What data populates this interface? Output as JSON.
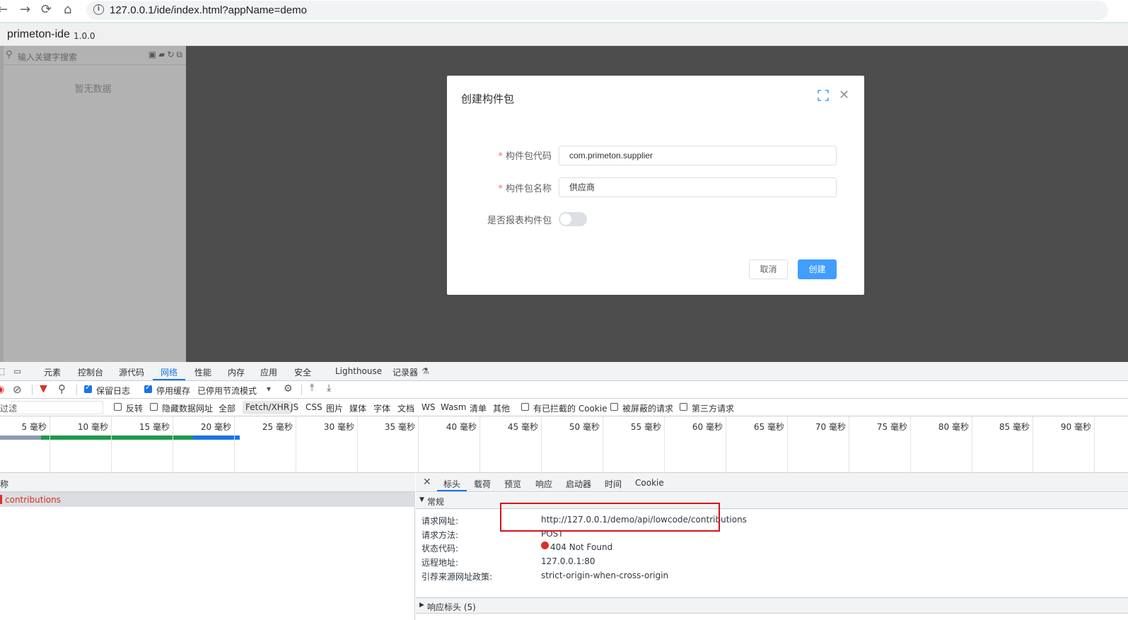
{
  "browser": {
    "url": "127.0.0.1/ide/index.html?appName=demo",
    "icons": [
      "back-icon",
      "forward-icon",
      "reload-icon",
      "home-icon",
      "info-icon"
    ]
  },
  "app": {
    "name": "primeton-ide",
    "version": "1.0.0"
  },
  "sidebar": {
    "search_placeholder": "输入关键字搜索",
    "empty_text": "暂无数据"
  },
  "dialog": {
    "title": "创建构件包",
    "fields": [
      {
        "label": "构件包代码",
        "required": true,
        "value": "com.primeton.supplier"
      },
      {
        "label": "构件包名称",
        "required": true,
        "value": "供应商"
      }
    ],
    "switch": {
      "label": "是否报表构件包",
      "on": false
    },
    "cancel_label": "取消",
    "create_label": "创建",
    "accent": "#409eff"
  },
  "devtools": {
    "tabs": [
      "元素",
      "控制台",
      "源代码",
      "网络",
      "性能",
      "内存",
      "应用",
      "安全",
      "Lighthouse",
      "记录器"
    ],
    "active_tab": "网络",
    "toolbar": {
      "preserve_log": "保留日志",
      "disable_cache": "停用缓存",
      "throttle": "已停用节流模式"
    },
    "filter": {
      "placeholder": "过滤",
      "invert": "反转",
      "hide_data_urls": "隐藏数据网址",
      "types": [
        "全部",
        "Fetch/XHR",
        "JS",
        "CSS",
        "图片",
        "媒体",
        "字体",
        "文档",
        "WS",
        "Wasm",
        "清单",
        "其他"
      ],
      "active_type": "Fetch/XHR",
      "blocked_cookies": "有已拦截的 Cookie",
      "blocked_requests": "被屏蔽的请求",
      "third_party": "第三方请求"
    },
    "timeline_ticks": [
      "5 毫秒",
      "10 毫秒",
      "15 毫秒",
      "20 毫秒",
      "25 毫秒",
      "30 毫秒",
      "35 毫秒",
      "40 毫秒",
      "45 毫秒",
      "50 毫秒",
      "55 毫秒",
      "60 毫秒",
      "65 毫秒",
      "70 毫秒",
      "75 毫秒",
      "80 毫秒",
      "85 毫秒",
      "90 毫秒"
    ],
    "request_list": {
      "header": "称",
      "rows": [
        {
          "name": "contributions",
          "status_color": "#d93025"
        }
      ]
    },
    "detail": {
      "tabs": [
        "标头",
        "载荷",
        "预览",
        "响应",
        "启动器",
        "时间",
        "Cookie"
      ],
      "active_tab": "标头",
      "general_title": "常规",
      "general": [
        {
          "key": "请求网址:",
          "value": "http://127.0.0.1/demo/api/lowcode/contributions"
        },
        {
          "key": "请求方法:",
          "value": "POST"
        },
        {
          "key": "状态代码:",
          "value": "404 Not Found"
        },
        {
          "key": "远程地址:",
          "value": "127.0.0.1:80"
        },
        {
          "key": "引荐来源网址政策:",
          "value": "strict-origin-when-cross-origin"
        }
      ],
      "response_headers_title": "响应标头 (5)"
    }
  }
}
